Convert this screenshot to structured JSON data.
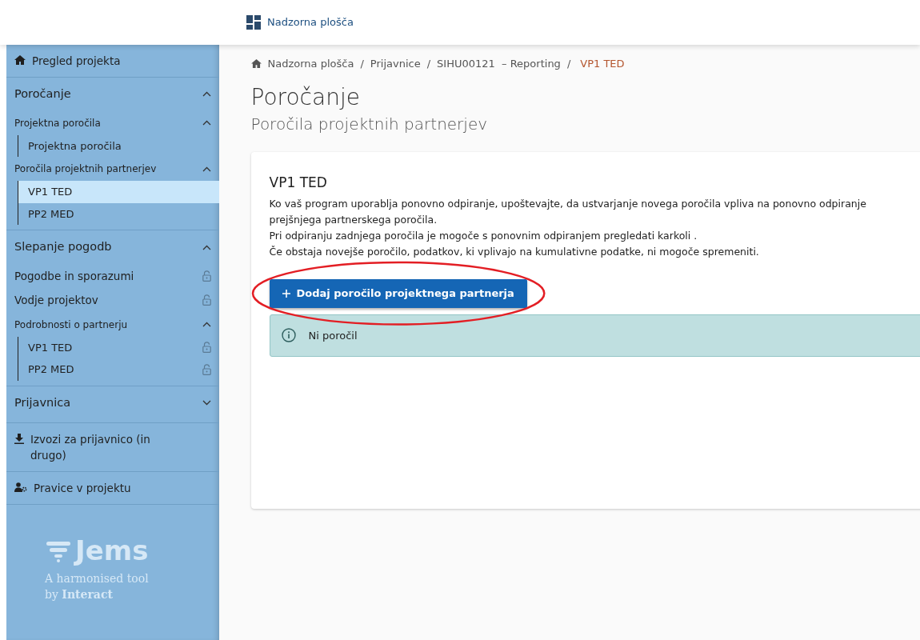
{
  "header": {
    "title": "Nadzorna plošča"
  },
  "sidebar": {
    "items": [
      {
        "kind": "link",
        "label": "Pregled projekta"
      },
      {
        "kind": "section",
        "label": "Poročanje",
        "expanded": true,
        "children": [
          {
            "kind": "group",
            "label": "Projektna poročila",
            "expanded": true,
            "children": [
              {
                "label": "Projektna poročila",
                "selected": false,
                "locked": false
              }
            ]
          },
          {
            "kind": "group",
            "label": "Poročila projektnih partnerjev",
            "expanded": true,
            "children": [
              {
                "label": "VP1 TED",
                "selected": true,
                "locked": false
              },
              {
                "label": "PP2 MED",
                "selected": false,
                "locked": false
              }
            ]
          }
        ]
      },
      {
        "kind": "section",
        "label": "Slepanje pogodb",
        "expanded": true,
        "children": [
          {
            "kind": "item",
            "label": "Pogodbe in sporazumi",
            "locked": true
          },
          {
            "kind": "item",
            "label": "Vodje projektov",
            "locked": true
          },
          {
            "kind": "group",
            "label": "Podrobnosti o partnerju",
            "expanded": true,
            "children": [
              {
                "label": "VP1 TED",
                "selected": false,
                "locked": true
              },
              {
                "label": "PP2 MED",
                "selected": false,
                "locked": true
              }
            ]
          }
        ]
      },
      {
        "kind": "section",
        "label": "Prijavnica",
        "expanded": false
      },
      {
        "kind": "link",
        "label": "Izvozi za prijavnico (in drugo)"
      },
      {
        "kind": "link",
        "label": "Pravice v projektu"
      }
    ],
    "logo": {
      "name": "Jems",
      "tagline": "A harmonised tool",
      "byline": "by **Interact**"
    }
  },
  "breadcrumb": [
    {
      "label": "Nadzorna plošča",
      "current": false
    },
    {
      "separator": "/",
      "label": "Prijavnice",
      "current": false
    },
    {
      "separator": "/",
      "label": "SIHU00121  – Reporting",
      "current": false
    },
    {
      "separator": "/",
      "label": "VP1 TED",
      "current": true
    }
  ],
  "page": {
    "title": "Poročanje",
    "subtitle": "Poročila projektnih partnerjev"
  },
  "card": {
    "title": "VP1 TED",
    "paragraphs": [
      "Ko vaš program uporablja ponovno odpiranje, upoštevajte, da ustvarjanje novega poročila vpliva na ponovno odpiranje prejšnjega partnerskega poročila.",
      "Pri odpiranju zadnjega poročila je mogoče s ponovnim odpiranjem pregledati karkoli .",
      "Če obstaja novejše poročilo, podatkov, ki vplivajo na kumulativne podatke, ni mogoče spremeniti."
    ],
    "button": {
      "label": "Dodaj poročilo projektnega partnerja"
    },
    "alert": {
      "text": "Ni poročil"
    }
  },
  "annotation": {
    "kind": "ellipse"
  }
}
